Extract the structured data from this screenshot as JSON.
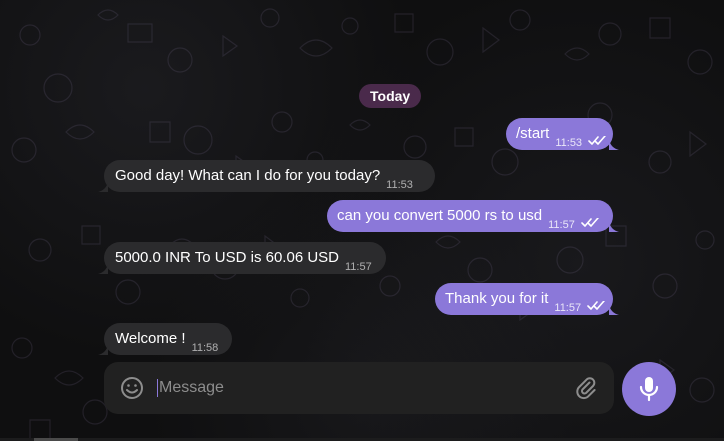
{
  "chat": {
    "date_label": "Today",
    "messages": [
      {
        "side": "out",
        "text": "/start",
        "time": "11:53",
        "read": true
      },
      {
        "side": "in",
        "text": "Good day! What can I do for you today?",
        "time": "11:53"
      },
      {
        "side": "out",
        "text": "can you convert 5000 rs to usd",
        "time": "11:57",
        "read": true
      },
      {
        "side": "in",
        "text": "5000.0 INR To USD is 60.06 USD",
        "time": "11:57"
      },
      {
        "side": "out",
        "text": "Thank you for it",
        "time": "11:57",
        "read": true
      },
      {
        "side": "in",
        "text": "Welcome !",
        "time": "11:58"
      }
    ]
  },
  "composer": {
    "placeholder": "Message"
  },
  "icons": {
    "emoji": "smile-icon",
    "attach": "paperclip-icon",
    "send_voice": "microphone-icon",
    "read_receipt": "double-check-icon"
  },
  "colors": {
    "background": "#0f0f10",
    "incoming_bubble": "#2b2b2d",
    "outgoing_bubble": "#8b78d9",
    "date_pill": "#4a2a4b",
    "composer": "#212121",
    "accent": "#8b78d9"
  }
}
